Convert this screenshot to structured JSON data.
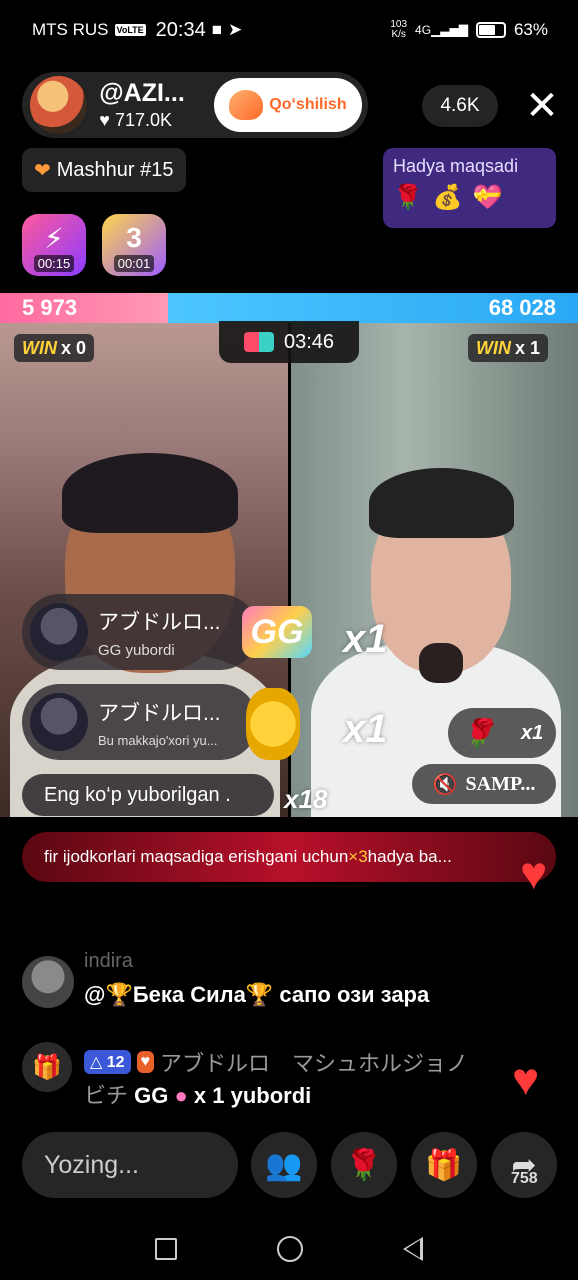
{
  "status": {
    "carrier": "MTS RUS",
    "volte": "VoLTE",
    "time": "20:34",
    "net_speed_value": "103",
    "net_speed_unit": "K/s",
    "network": "4G",
    "battery": "63%"
  },
  "host": {
    "name": "@AZI...",
    "likes": "717.0K",
    "follow_label": "Qo‘shilish"
  },
  "viewers": "4.6K",
  "rank": "Mashhur #15",
  "gift_goal": {
    "title": "Hadya maqsadi",
    "icons": [
      "rose-icon",
      "treasure-icon",
      "heart-box-icon"
    ]
  },
  "effects": [
    {
      "icon": "lightning-effect-icon",
      "time": "00:15"
    },
    {
      "icon": "x3-boost-icon",
      "time": "00:01"
    }
  ],
  "battle": {
    "score_left": "5 973",
    "score_right": "68 028",
    "win_word": "WIN",
    "win_left": "x 0",
    "win_right": "x 1",
    "timer": "03:46"
  },
  "gift_feed": [
    {
      "user": "アブドルロ...",
      "message": "GG  yubordi",
      "multiplier": "x1"
    },
    {
      "user": "アブドルロ...",
      "message": "Bu makkajo'xori  yu...",
      "multiplier": "x1"
    }
  ],
  "gg_label": "GG",
  "top_gifter": "Eng ko‘p yuborilgan .",
  "top_gifter_multiplier": "x18",
  "rose_pill": {
    "count": "x1"
  },
  "sample_label": "SAMP...",
  "banner": {
    "text_before": "fir ijodkorlari maqsadiga erishgani uchun ",
    "highlight": "×3",
    "text_after": " hadya ba..."
  },
  "chat": [
    {
      "user": "indira",
      "text": "@🏆Бека Сила🏆 сапо ози зара"
    }
  ],
  "gift_message": {
    "level": "12",
    "fan_level": "",
    "line1": "アブドルロ　マシュホルジョノ",
    "line2_user": "ビチ",
    "line2_gift": "GG",
    "line2_rest": "x 1 yubordi"
  },
  "input_placeholder": "Yozing...",
  "share_count": "758",
  "colors": {
    "left_score": "#ff7ea8",
    "right_score": "#3bb8f8",
    "follow_accent": "#ff6a2a",
    "goal_bg": "#3f2a80",
    "banner": "#b8102a"
  }
}
